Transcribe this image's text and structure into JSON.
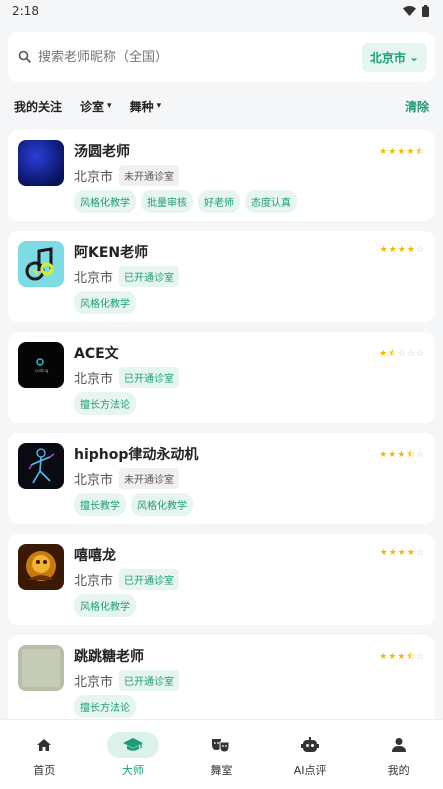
{
  "statusbar": {
    "time": "2:18"
  },
  "search": {
    "placeholder": "搜索老师昵称（全国）",
    "city": "北京市"
  },
  "filters": {
    "follow": "我的关注",
    "studio": "诊室",
    "dance": "舞种",
    "clear": "清除"
  },
  "teachers": [
    {
      "name": "汤圆老师",
      "city": "北京市",
      "status": "未开通诊室",
      "status_open": false,
      "rating": 4.5,
      "tags": [
        "风格化教学",
        "批量审核",
        "好老师",
        "态度认真"
      ]
    },
    {
      "name": "阿KEN老师",
      "city": "北京市",
      "status": "已开通诊室",
      "status_open": true,
      "rating": 4,
      "tags": [
        "风格化教学"
      ]
    },
    {
      "name": "ACE文",
      "city": "北京市",
      "status": "已开通诊室",
      "status_open": true,
      "rating": 1.5,
      "tags": [
        "擅长方法论"
      ]
    },
    {
      "name": "hiphop律动永动机",
      "city": "北京市",
      "status": "未开通诊室",
      "status_open": false,
      "rating": 3.5,
      "tags": [
        "擅长教学",
        "风格化教学"
      ]
    },
    {
      "name": "嘻嘻龙",
      "city": "北京市",
      "status": "已开通诊室",
      "status_open": true,
      "rating": 4,
      "tags": [
        "风格化教学"
      ]
    },
    {
      "name": "跳跳糖老师",
      "city": "北京市",
      "status": "已开通诊室",
      "status_open": true,
      "rating": 3.5,
      "tags": [
        "擅长方法论"
      ]
    }
  ],
  "nav": [
    {
      "label": "首页",
      "icon": "home-icon",
      "active": false
    },
    {
      "label": "大师",
      "icon": "graduation-cap-icon",
      "active": true
    },
    {
      "label": "舞室",
      "icon": "theater-masks-icon",
      "active": false
    },
    {
      "label": "AI点评",
      "icon": "robot-icon",
      "active": false
    },
    {
      "label": "我的",
      "icon": "user-icon",
      "active": false
    }
  ],
  "colors": {
    "accent": "#1f9b78",
    "star": "#f5b800"
  }
}
